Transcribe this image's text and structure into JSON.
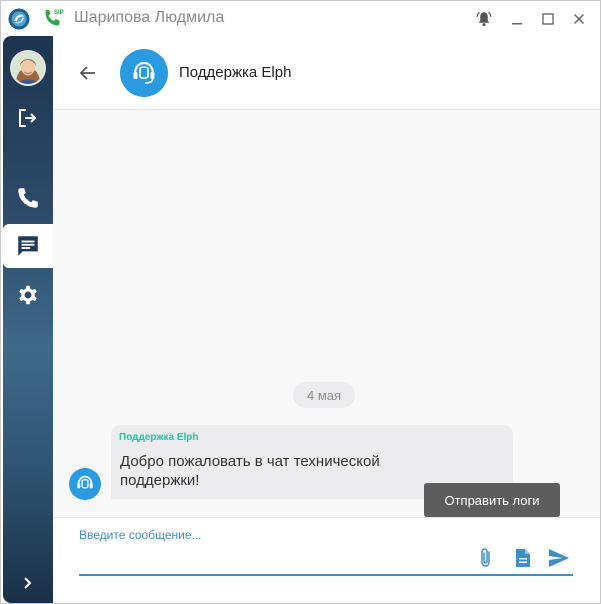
{
  "titlebar": {
    "sip_badge": "SIP",
    "user_name": "Шарипова Людмила"
  },
  "chat": {
    "title": "Поддержка Elph",
    "date_separator": "4 мая",
    "messages": [
      {
        "sender": "Поддержка Elph",
        "text": "Добро пожаловать в чат технической поддержки!"
      }
    ],
    "tooltip": "Отправить логи"
  },
  "composer": {
    "placeholder": "Введите сообщение..."
  },
  "icons": {
    "app": "app-logo-icon",
    "sip": "sip-phone-icon",
    "bell": "bell-icon",
    "minimize": "minimize-icon",
    "maximize": "maximize-icon",
    "close": "close-icon",
    "logout": "logout-icon",
    "phone": "phone-icon",
    "chat": "chat-icon",
    "settings": "gear-icon",
    "expand": "chevron-right-icon",
    "back": "arrow-left-icon",
    "support": "headset-icon",
    "attach": "paperclip-icon",
    "document": "document-icon",
    "send": "send-icon"
  },
  "colors": {
    "accent": "#2a9be0",
    "sender": "#1fc9a0",
    "sip_green": "#2ea84a"
  }
}
